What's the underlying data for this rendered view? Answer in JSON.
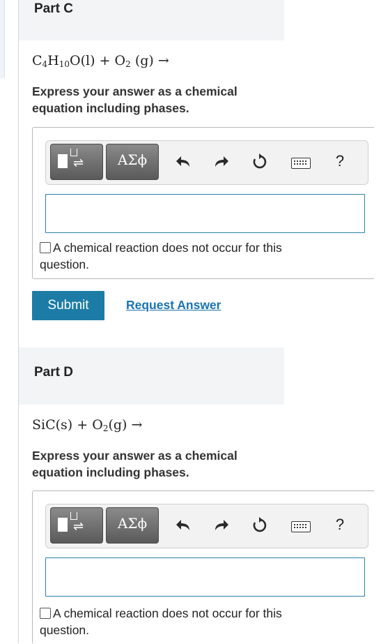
{
  "partC": {
    "title": "Part C",
    "equation": {
      "c": "C",
      "c_sub": "4",
      "h": "H",
      "h_sub": "10",
      "o": "O",
      "phase1": "(l)",
      "plus": "+",
      "o2": "O",
      "o2_sub": "2",
      "phase2": "(g)",
      "arrow": "→"
    },
    "instruction": "Express your answer as a chemical equation including phases.",
    "greek_label": "AΣϕ",
    "help_label": "?",
    "input_value": "",
    "no_reaction_text": "A chemical reaction does not occur for this question."
  },
  "actions": {
    "submit_label": "Submit",
    "request_label": "Request Answer"
  },
  "partD": {
    "title": "Part D",
    "equation": {
      "sic": "SiC",
      "phase1": "(s)",
      "plus": "+",
      "o2": "O",
      "o2_sub": "2",
      "phase2": "(g)",
      "arrow": "→"
    },
    "instruction": "Express your answer as a chemical equation including phases.",
    "greek_label": "AΣϕ",
    "help_label": "?",
    "input_value": "",
    "no_reaction_text": "A chemical reaction does not occur for this question."
  },
  "colors": {
    "accent": "#1c7ca5",
    "link": "#1a73b0",
    "input_border": "#2b7fa4"
  },
  "icons": [
    "templates-icon",
    "undo-icon",
    "redo-icon",
    "reset-icon",
    "keyboard-icon",
    "help-icon"
  ]
}
